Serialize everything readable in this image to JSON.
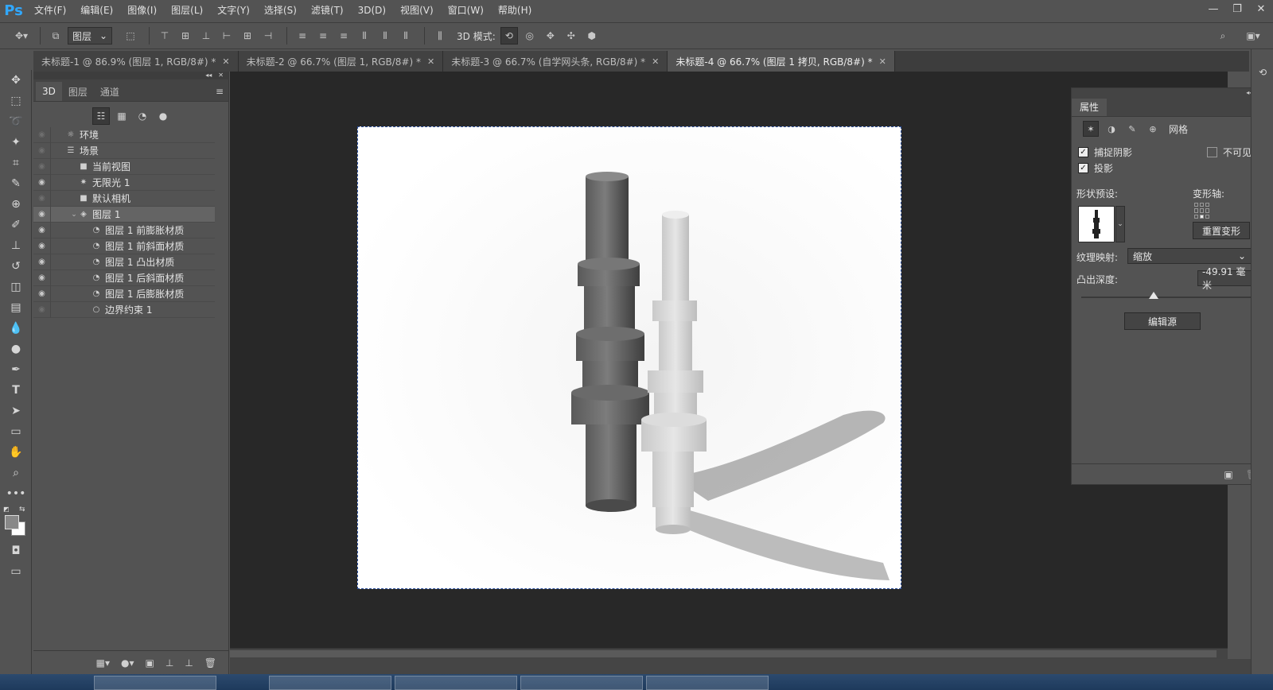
{
  "app": {
    "logo": "Ps"
  },
  "menu": [
    "文件(F)",
    "编辑(E)",
    "图像(I)",
    "图层(L)",
    "文字(Y)",
    "选择(S)",
    "滤镜(T)",
    "3D(D)",
    "视图(V)",
    "窗口(W)",
    "帮助(H)"
  ],
  "options": {
    "layer_select": "图层",
    "mode3d_label": "3D 模式:"
  },
  "tabs": [
    {
      "label": "未标题-1 @ 86.9% (图层 1, RGB/8#) *",
      "active": false
    },
    {
      "label": "未标题-2 @ 66.7% (图层 1, RGB/8#) *",
      "active": false
    },
    {
      "label": "未标题-3 @ 66.7% (自学网头条, RGB/8#) *",
      "active": false
    },
    {
      "label": "未标题-4 @ 66.7% (图层 1 拷贝, RGB/8#) *",
      "active": true
    }
  ],
  "panel3d": {
    "tabs": [
      "3D",
      "图层",
      "通道"
    ],
    "rows": [
      {
        "label": "环境",
        "indent": 0,
        "icon": "☼",
        "eye": false,
        "expand": ""
      },
      {
        "label": "场景",
        "indent": 0,
        "icon": "☰",
        "eye": false,
        "expand": ""
      },
      {
        "label": "当前视图",
        "indent": 1,
        "icon": "■",
        "eye": false,
        "expand": ""
      },
      {
        "label": "无限光 1",
        "indent": 1,
        "icon": "✷",
        "eye": true,
        "expand": ""
      },
      {
        "label": "默认相机",
        "indent": 1,
        "icon": "■",
        "eye": false,
        "expand": ""
      },
      {
        "label": "图层 1",
        "indent": 1,
        "icon": "◈",
        "eye": true,
        "expand": "⌄",
        "selected": true
      },
      {
        "label": "图层 1 前膨胀材质",
        "indent": 2,
        "icon": "◔",
        "eye": true,
        "expand": ""
      },
      {
        "label": "图层 1 前斜面材质",
        "indent": 2,
        "icon": "◔",
        "eye": true,
        "expand": ""
      },
      {
        "label": "图层 1 凸出材质",
        "indent": 2,
        "icon": "◔",
        "eye": true,
        "expand": ""
      },
      {
        "label": "图层 1 后斜面材质",
        "indent": 2,
        "icon": "◔",
        "eye": true,
        "expand": ""
      },
      {
        "label": "图层 1 后膨胀材质",
        "indent": 2,
        "icon": "◔",
        "eye": true,
        "expand": ""
      },
      {
        "label": "边界约束 1",
        "indent": 2,
        "icon": "○",
        "eye": false,
        "expand": ""
      }
    ]
  },
  "props": {
    "title": "属性",
    "mesh_label": "网格",
    "catch_shadow": "捕捉阴影",
    "cast_shadow": "投影",
    "invisible": "不可见",
    "shape_preset": "形状预设:",
    "deform_axis": "变形轴:",
    "reset_deform": "重置变形",
    "texture_map_label": "纹理映射:",
    "texture_map_value": "缩放",
    "extrude_depth_label": "凸出深度:",
    "extrude_depth_value": "-49.91 毫米",
    "extrude_depth_fraction": 0.42,
    "edit_source": "编辑源"
  }
}
